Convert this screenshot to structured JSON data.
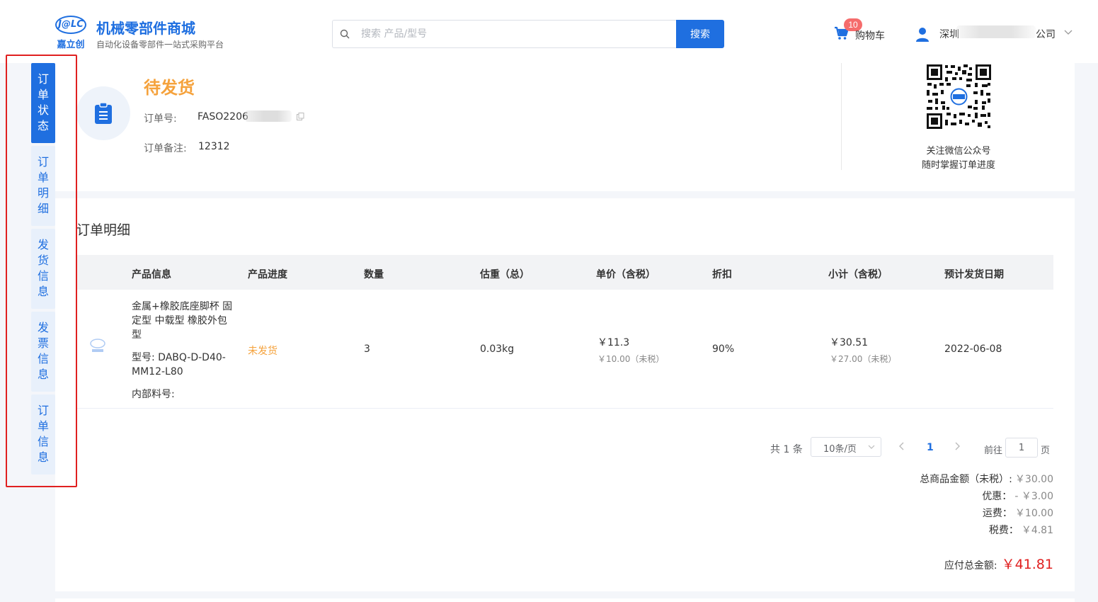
{
  "header": {
    "logo_mark": "J@LC",
    "logo_cn": "嘉立创",
    "brand_title": "机械零部件商城",
    "brand_subtitle": "自动化设备零部件一站式采购平台",
    "search_placeholder": "搜索 产品/型号",
    "search_button": "搜索",
    "cart_count": "10",
    "cart_label": "购物车",
    "user_name_prefix": "深圳",
    "user_name_suffix": "公司"
  },
  "side_nav": [
    {
      "label": "订单状态",
      "active": true
    },
    {
      "label": "订单明细",
      "active": false
    },
    {
      "label": "发货信息",
      "active": false
    },
    {
      "label": "发票信息",
      "active": false
    },
    {
      "label": "订单信息",
      "active": false
    }
  ],
  "status": {
    "title": "待发货",
    "order_no_label": "订单号:",
    "order_no_value": "FASO2206",
    "remark_label": "订单备注:",
    "remark_value": "12312",
    "qr_line1": "关注微信公众号",
    "qr_line2": "随时掌握订单进度"
  },
  "detail": {
    "title": "订单明细",
    "columns": [
      "产品信息",
      "产品进度",
      "数量",
      "估重（总）",
      "单价（含税）",
      "折扣",
      "小计（含税）",
      "预计发货日期"
    ],
    "rows": [
      {
        "name": "金属+橡胶底座脚杯 固定型 中载型 橡胶外包型",
        "model": "型号: DABQ-D-D40-MM12-L80",
        "inner_no": "内部料号:",
        "progress": "未发货",
        "qty": "3",
        "weight": "0.03kg",
        "unit_price": "￥11.3",
        "unit_price_untaxed": "￥10.00（未税）",
        "discount": "90%",
        "subtotal": "￥30.51",
        "subtotal_untaxed": "￥27.00（未税）",
        "ship_date": "2022-06-08"
      }
    ]
  },
  "pagination": {
    "total": "共 1 条",
    "page_size": "10条/页",
    "current_page": "1",
    "goto_label": "前往",
    "goto_value": "1",
    "page_label": "页"
  },
  "summary": {
    "goods_label": "总商品金额（未税）:",
    "goods_value": "￥30.00",
    "discount_label": "优惠：",
    "discount_value": "- ￥3.00",
    "shipping_label": "运费：",
    "shipping_value": "￥10.00",
    "tax_label": "税费：",
    "tax_value": "￥4.81",
    "total_label": "应付总金额:",
    "total_value": "￥41.81"
  },
  "colors": {
    "brand_blue": "#1f6fe0",
    "status_orange": "#f5a23c",
    "total_red": "#e02020",
    "highlight_box": "#e02020"
  }
}
